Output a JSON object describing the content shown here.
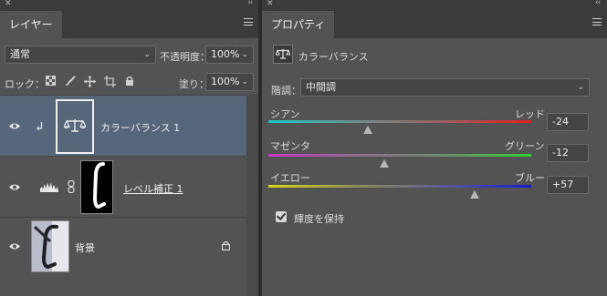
{
  "layers_panel": {
    "tab": "レイヤー",
    "blend_mode": "通常",
    "opacity_label": "不透明度：",
    "opacity_value": "100%",
    "lock_label": "ロック：",
    "fill_label": "塗り：",
    "fill_value": "100%",
    "layers": [
      {
        "name": "カラーバランス 1",
        "selected": true
      },
      {
        "name": "レベル補正 1",
        "selected": false
      },
      {
        "name": "背景",
        "selected": false
      }
    ]
  },
  "properties_panel": {
    "tab": "プロパティ",
    "title": "カラーバランス",
    "tone_label": "階調：",
    "tone_value": "中間調",
    "sliders": [
      {
        "left": "シアン",
        "right": "レッド",
        "value": "-24",
        "level": -24
      },
      {
        "left": "マゼンタ",
        "right": "グリーン",
        "value": "-12",
        "level": -12
      },
      {
        "left": "イエロー",
        "right": "ブルー",
        "value": "+57",
        "level": 57
      }
    ],
    "preserve_luminosity": "輝度を保持"
  },
  "colors": {
    "selected_layer": "#56667b",
    "panel": "#535353"
  }
}
